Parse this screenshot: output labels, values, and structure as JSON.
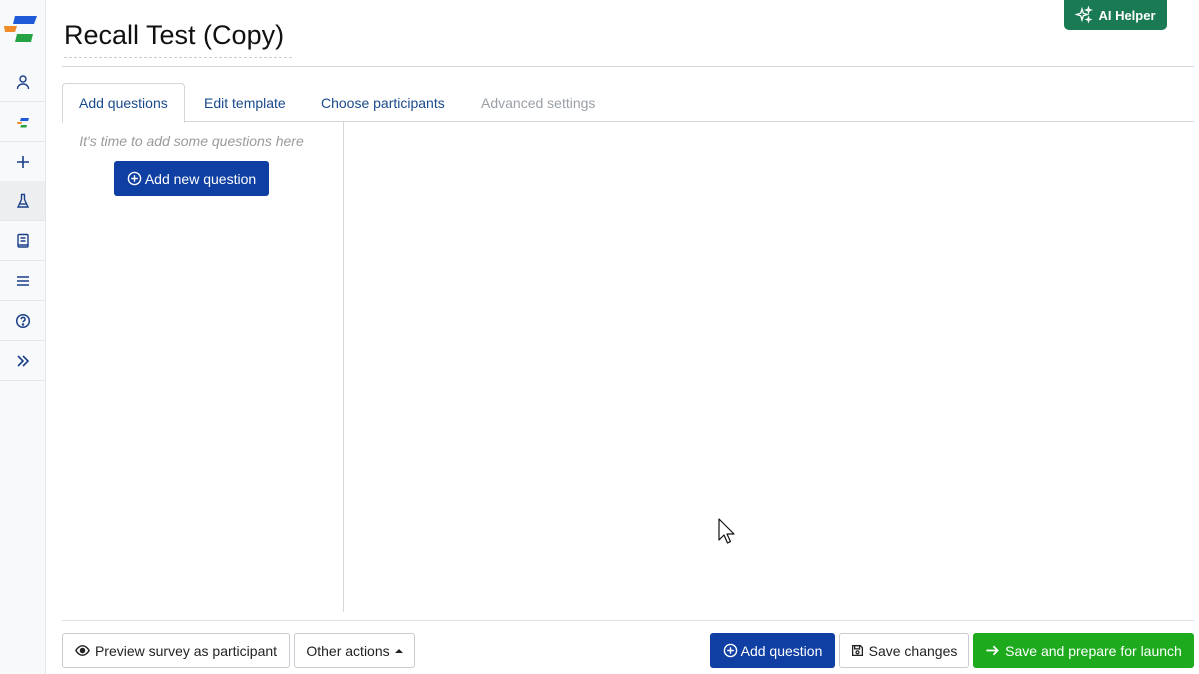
{
  "survey": {
    "title": "Recall Test (Copy)"
  },
  "ai_helper": {
    "label": "AI Helper",
    "icon": "sparkles-icon"
  },
  "sidebar": {
    "items": [
      {
        "name": "user-icon"
      },
      {
        "name": "brand-mini-icon"
      },
      {
        "name": "plus-icon"
      },
      {
        "name": "flask-icon"
      },
      {
        "name": "book-icon"
      },
      {
        "name": "list-icon"
      },
      {
        "name": "help-icon"
      },
      {
        "name": "expand-icon"
      }
    ]
  },
  "tabs": [
    {
      "label": "Add questions",
      "state": "active"
    },
    {
      "label": "Edit template",
      "state": "normal"
    },
    {
      "label": "Choose participants",
      "state": "normal"
    },
    {
      "label": "Advanced settings",
      "state": "disabled"
    }
  ],
  "questions_pane": {
    "hint": "It's time to add some questions here",
    "add_new_label": "Add new question"
  },
  "footer": {
    "preview_label": "Preview survey as participant",
    "other_actions_label": "Other actions",
    "add_question_label": "Add question",
    "save_changes_label": "Save changes",
    "save_launch_label": "Save and prepare for launch"
  },
  "colors": {
    "primary": "#0f3fa3",
    "success": "#1daa1d",
    "ai_helper": "#197a53",
    "tab_link": "#1a4a8b"
  }
}
